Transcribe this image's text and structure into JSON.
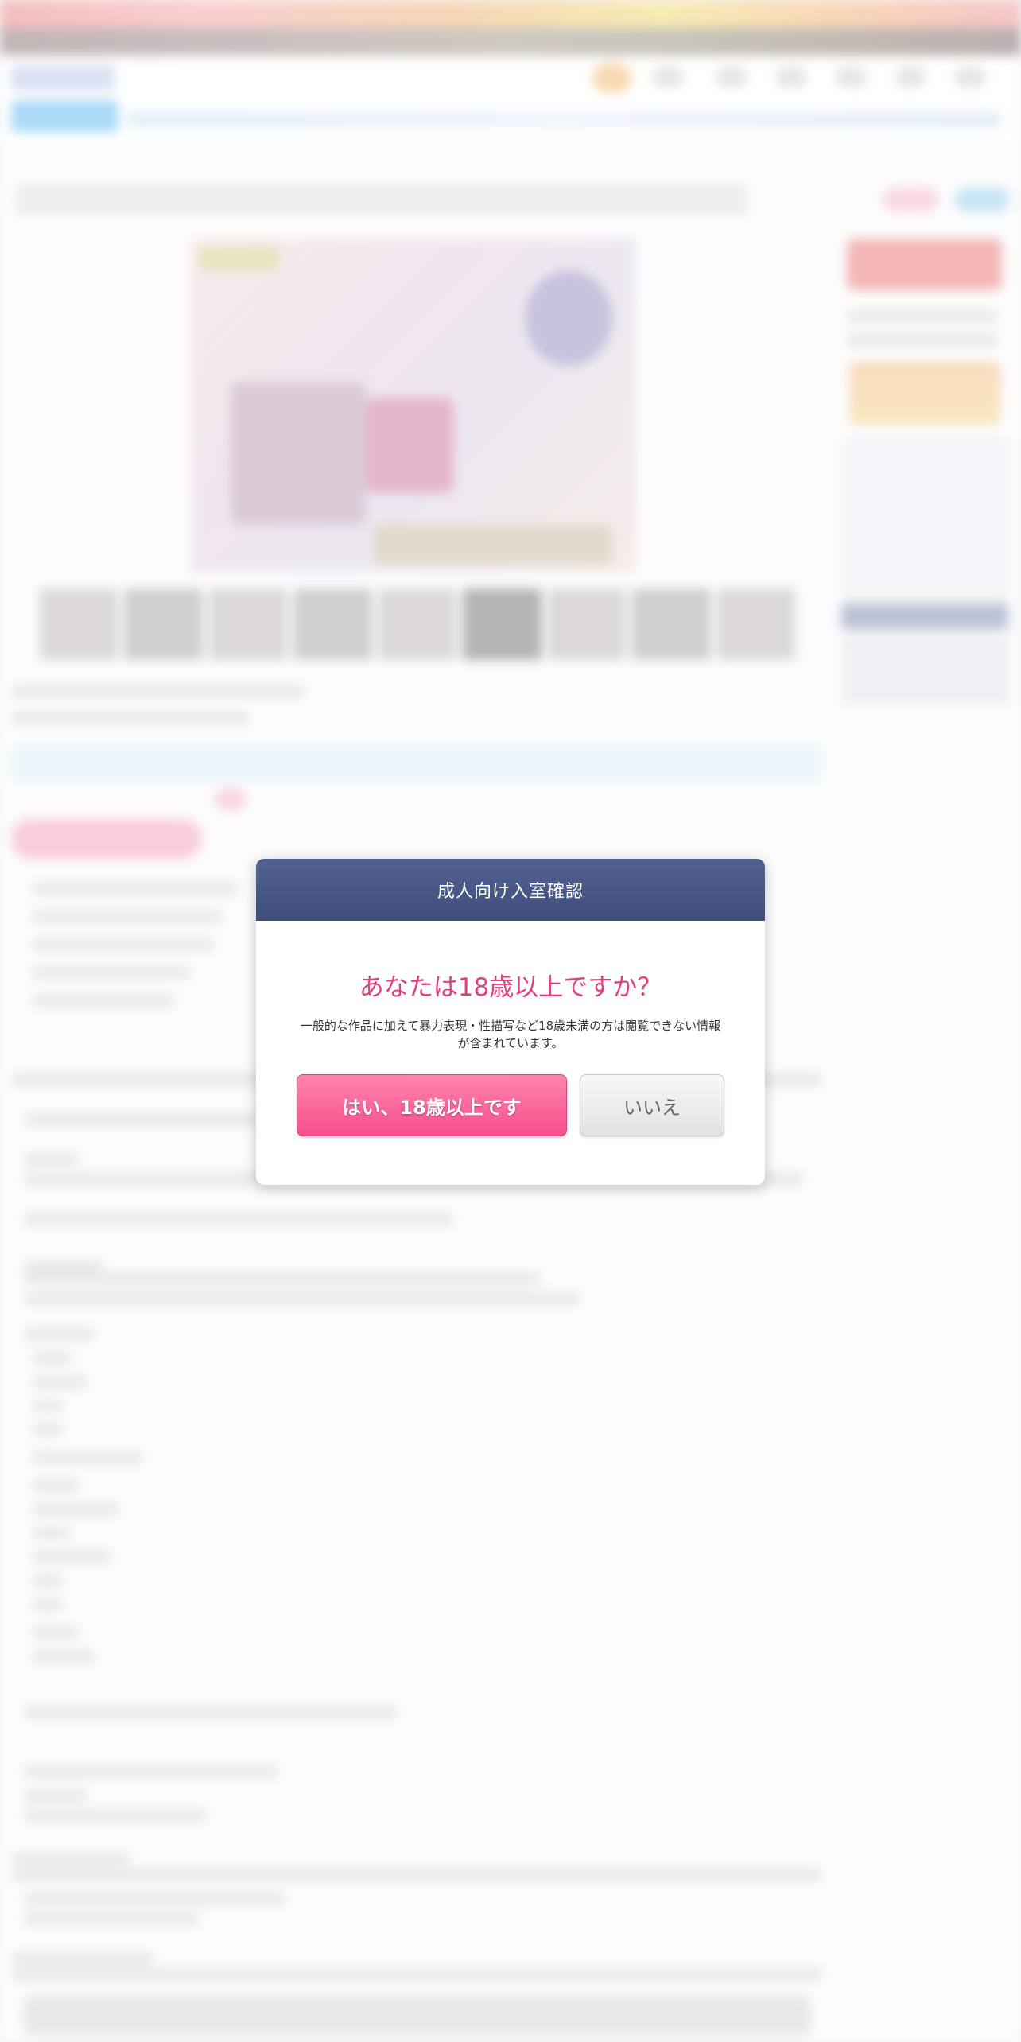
{
  "modal": {
    "title": "成人向け入室確認",
    "question": "あなたは18歳以上ですか？",
    "note": "一般的な作品に加えて暴力表現・性描写など18歳未満の方は閲覧できない情報が含まれています。",
    "yes_label": "はい、18歳以上です",
    "no_label": "いいえ"
  },
  "colors": {
    "header_bg": "#45547f",
    "question_text": "#e0407d",
    "yes_button": "#f74f8d",
    "no_button": "#e8e8e8"
  }
}
